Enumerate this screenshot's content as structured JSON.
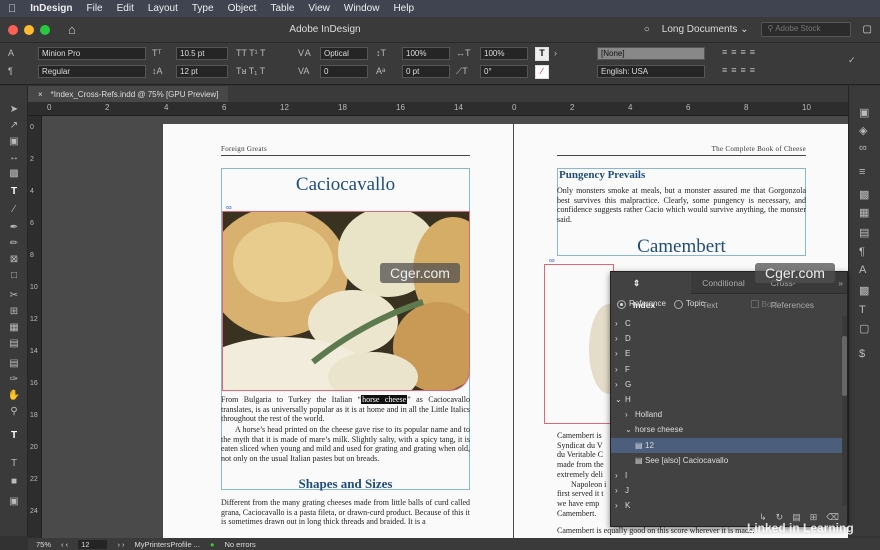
{
  "menubar": {
    "app": "InDesign",
    "items": [
      "File",
      "Edit",
      "Layout",
      "Type",
      "Object",
      "Table",
      "View",
      "Window",
      "Help"
    ]
  },
  "appbar": {
    "title": "Adobe InDesign",
    "workspace": "Long Documents",
    "workspace_icon": "chevron-down-icon",
    "search_placeholder": "Adobe Stock"
  },
  "control": {
    "font_family": "Minion Pro",
    "font_style": "Regular",
    "font_size": "10.5 pt",
    "leading": "12 pt",
    "kerning": "Optical",
    "tracking": "0",
    "vscale": "100%",
    "hscale": "100%",
    "baseline": "0 pt",
    "skew": "0°",
    "swatch": "[None]",
    "language": "English: USA"
  },
  "doc_tab": {
    "label": "*Index_Cross-Refs.indd @ 75% [GPU Preview]"
  },
  "ruler": {
    "top": [
      "0",
      "2",
      "4",
      "6",
      "8",
      "10",
      "12",
      "18",
      "16",
      "14",
      "12",
      "10",
      "8",
      "6",
      "4",
      "2",
      "0",
      "2",
      "4",
      "6",
      "8",
      "10",
      "12"
    ],
    "left": [
      "0",
      "2",
      "4",
      "6",
      "8",
      "10",
      "12",
      "14",
      "16",
      "18",
      "20",
      "22",
      "24"
    ]
  },
  "page_left": {
    "running_head": "Foreign Greats",
    "title": "Caciocavallo",
    "para1_a": "From Bulgaria to Turkey the Italian “",
    "para1_hl": "horse cheese",
    "para1_b": "” as Caciocavallo translates, is as universally popular as it is at home and in all the Little Italics throughout the rest of the world.",
    "para2": "A horse’s head printed on the cheese gave rise to its popular name and to the myth that it is made of mare’s milk. Slightly salty, with a spicy tang, it is eaten sliced when young and mild and used for grating and grating when old, not only on the usual Italian pastes but on breads.",
    "section": "Shapes and Sizes",
    "para3": "Different from the many grating cheeses made from little balls of curd called grana, Caciocavallo is a pasta fileta, or drawn-curd product. Because of this it is sometimes drawn out in long thick threads and braided. It is a"
  },
  "page_right": {
    "running_head": "The Complete Book of Cheese",
    "subhead": "Pungency Prevails",
    "para1": "Only monsters smoke at meals, but a monster assured me that Gorgonzola best survives this malpractice. Clearly, some pungency is necessary, and confidence suggests rather Cacio which would survive anything, the monster said.",
    "title": "Camembert",
    "frag_lines": [
      "Camembert is",
      "Syndicat du V",
      "du Veritable C",
      "made from the",
      "extremely deli",
      "Napoleon i",
      "first served it t",
      "we have emp",
      "Camembert."
    ],
    "last_line": "Camembert is equally good on this score wherever it is made."
  },
  "index_panel": {
    "tabs": [
      "Index",
      "Conditional Text",
      "Cross-References"
    ],
    "mode_reference": "Reference",
    "mode_topic": "Topic",
    "book": "Book",
    "rows": [
      {
        "label": "C",
        "level": 0,
        "caret": "›"
      },
      {
        "label": "D",
        "level": 0,
        "caret": "›"
      },
      {
        "label": "E",
        "level": 0,
        "caret": "›"
      },
      {
        "label": "F",
        "level": 0,
        "caret": "›"
      },
      {
        "label": "G",
        "level": 0,
        "caret": "›"
      },
      {
        "label": "H",
        "level": 0,
        "caret": "⌄"
      },
      {
        "label": "Holland",
        "level": 1,
        "caret": "›"
      },
      {
        "label": "horse cheese",
        "level": 1,
        "caret": "⌄"
      },
      {
        "label": "12",
        "level": 2,
        "caret": "",
        "selected": true
      },
      {
        "label": "See [also] Caciocavallo",
        "level": 2,
        "caret": ""
      },
      {
        "label": "I",
        "level": 0,
        "caret": "›"
      },
      {
        "label": "J",
        "level": 0,
        "caret": "›"
      },
      {
        "label": "K",
        "level": 0,
        "caret": "›"
      }
    ]
  },
  "status": {
    "zoom": "75%",
    "page": "12",
    "profile": "MyPrintersProfile ...",
    "errors": "No errors"
  },
  "watermarks": {
    "cger": "Cger.com",
    "linkedin": "Linked in Learning"
  }
}
